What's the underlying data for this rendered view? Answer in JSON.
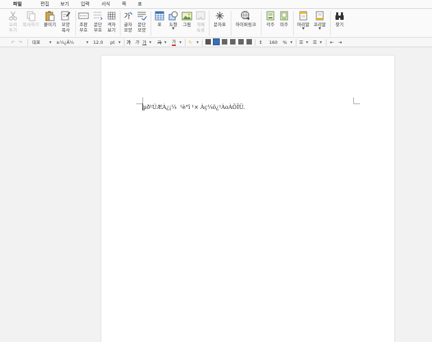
{
  "menu": {
    "items": [
      "파일",
      "편집",
      "보기",
      "입력",
      "서식",
      "쪽",
      "표"
    ]
  },
  "ribbon": {
    "cut": "오려\n두기",
    "copy": "복사하기",
    "paste": "붙이기",
    "format_copy": "모양\n복사",
    "markup_view": "조판\n부호",
    "para_mark": "문단\n부호",
    "grid_view": "격자\n보기",
    "char_shape": "글자\n모양",
    "para_shape": "문단\n모양",
    "table": "표",
    "shape": "도형",
    "picture": "그림",
    "object_prop": "개체\n속성",
    "symbol": "문자표",
    "hyperlink": "하이퍼링크",
    "footnote": "각주",
    "endnote": "미주",
    "header": "머리말",
    "footer": "꼬리말",
    "find": "찾기"
  },
  "format": {
    "style": "대표",
    "font": "±¼¿Ã¼",
    "size": "12.0",
    "unit": "pt",
    "bold": "가",
    "italic": "가",
    "underline": "가",
    "strike": "가",
    "color": "가",
    "line_spacing": "160",
    "percent": "%"
  },
  "colors": {
    "accent_blue": "#3b6fb6",
    "highlight_yellow": "#f5d31c",
    "font_red": "#d32f2f"
  },
  "document": {
    "text": "µð¹ÚÆÀ¿¡¼  ¹è°î ¹× Àç¼ö¿¹ÀoÀÔÏÜ."
  }
}
